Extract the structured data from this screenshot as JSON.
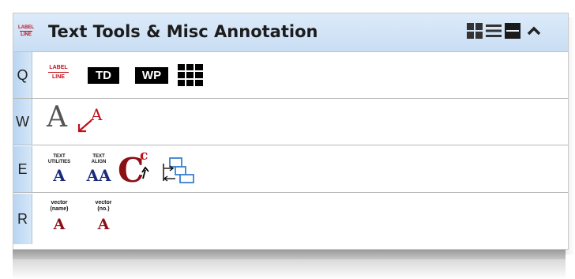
{
  "panel": {
    "title": "Text Tools & Misc Annotation",
    "title_icon_top": "LABEL",
    "title_icon_bottom": "LINE"
  },
  "toolbar": {
    "grid_view_icon": "grid-icon",
    "list_view_icon": "list-icon",
    "compact_view_icon": "compact-icon",
    "collapse_icon": "chevron-up-icon"
  },
  "rows": [
    {
      "key": "Q"
    },
    {
      "key": "W"
    },
    {
      "key": "E"
    },
    {
      "key": "R"
    }
  ],
  "tools": {
    "label_line": {
      "top": "LABEL",
      "bottom": "LINE"
    },
    "td": "TD",
    "wp": "WP",
    "text_big": "A",
    "leader_text": "A",
    "text_utilities": {
      "line1": "TEXT",
      "line2": "UTILITIES",
      "glyph": "A"
    },
    "text_align": {
      "line1": "TEXT",
      "line2": "ALIGN",
      "glyph": "AA"
    },
    "change_case": {
      "big": "C",
      "small": "c"
    },
    "vector_name": {
      "line1": "vector",
      "line2": "(name)",
      "glyph": "A"
    },
    "vector_no": {
      "line1": "vector",
      "line2": "(no.)",
      "glyph": "A"
    }
  },
  "colors": {
    "title_bg": "#c9ddf3",
    "key_bg": "#b8d5f2",
    "red_accent": "#c0101a",
    "dark_red": "#8b1015",
    "navy": "#1a2a7a",
    "blue_icon": "#3a7fd0"
  }
}
